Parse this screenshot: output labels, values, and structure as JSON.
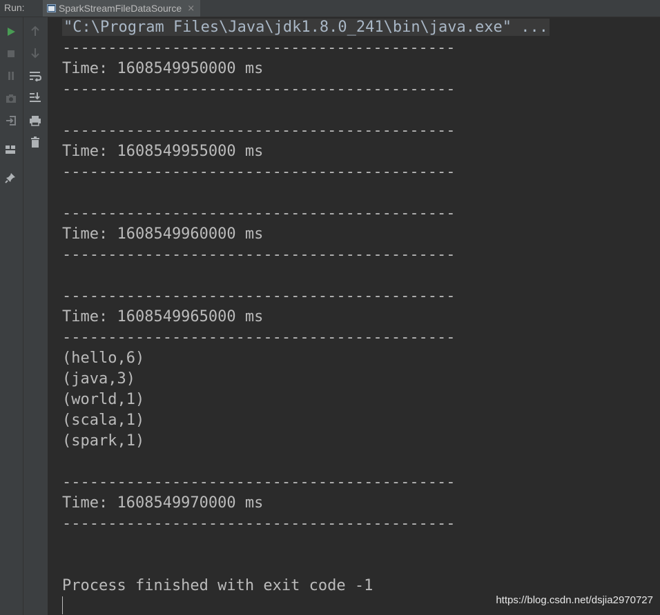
{
  "toolbar": {
    "run_label": "Run:"
  },
  "tab": {
    "label": "SparkStreamFileDataSource",
    "close": "×"
  },
  "gutter": {
    "left_icons": [
      "run-icon",
      "stop-icon",
      "pause-icon",
      "camera-icon",
      "login-icon",
      "layout-icon",
      "pin-icon"
    ],
    "right_icons": [
      "up-arrow-icon",
      "down-arrow-icon",
      "soft-wrap-icon",
      "scroll-to-end-icon",
      "print-icon",
      "trash-icon"
    ]
  },
  "console": {
    "command": "\"C:\\Program Files\\Java\\jdk1.8.0_241\\bin\\java.exe\" ...",
    "separator": "-------------------------------------------",
    "time1": "Time: 1608549950000 ms",
    "time2": "Time: 1608549955000 ms",
    "time3": "Time: 1608549960000 ms",
    "time4": "Time: 1608549965000 ms",
    "results": [
      "(hello,6)",
      "(java,3)",
      "(world,1)",
      "(scala,1)",
      "(spark,1)"
    ],
    "time5": "Time: 1608549970000 ms",
    "exit": "Process finished with exit code -1"
  },
  "watermark": "https://blog.csdn.net/dsjia2970727",
  "colors": {
    "run_green": "#499c54",
    "background": "#2b2b2b",
    "panel": "#3c3f41",
    "text": "#bbbbbb"
  }
}
